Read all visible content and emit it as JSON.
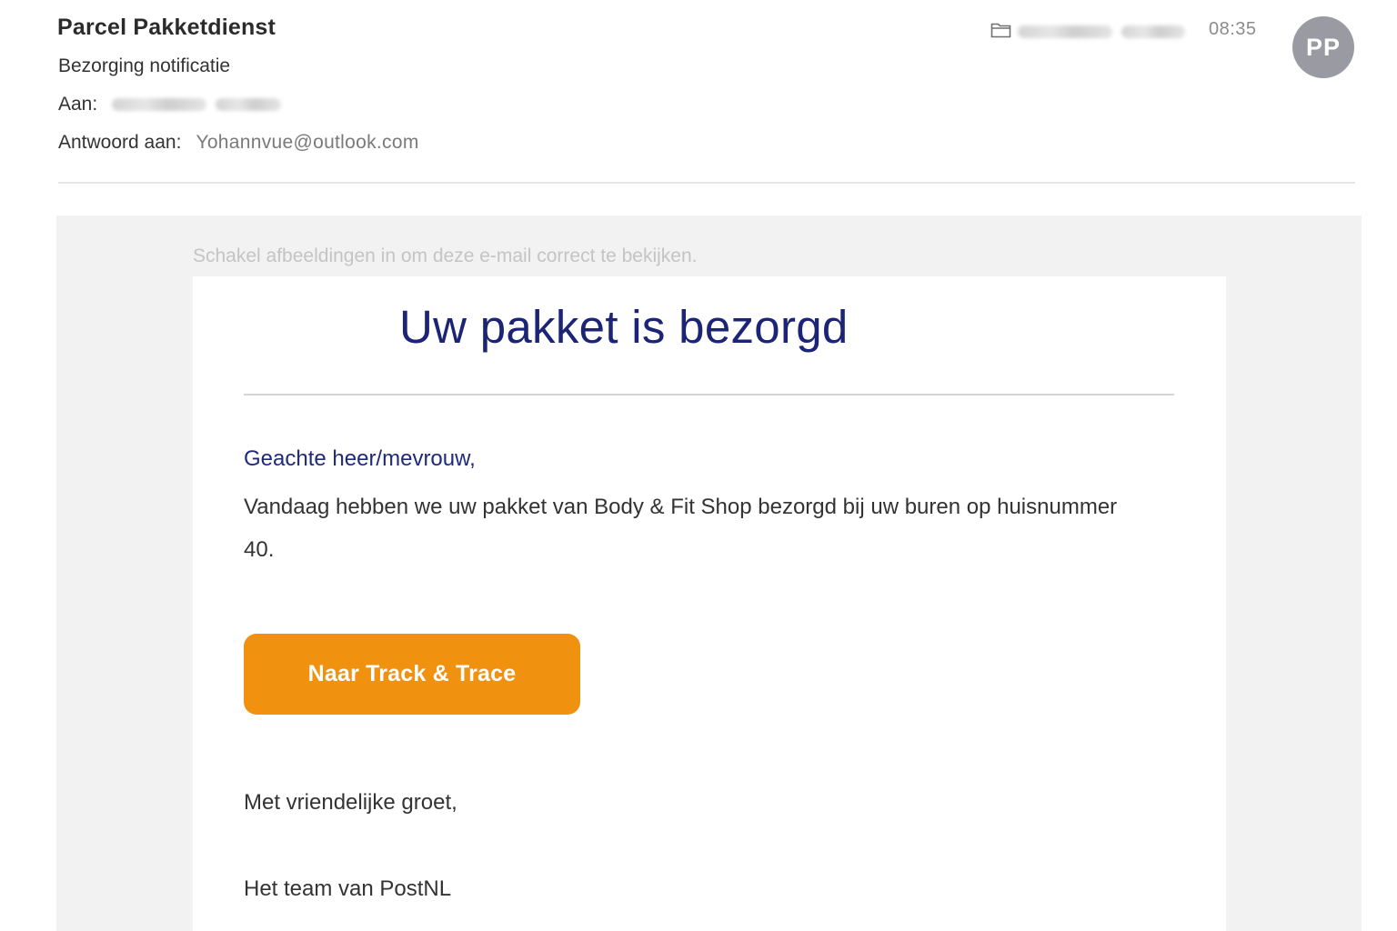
{
  "email": {
    "sender_name": "Parcel Pakketdienst",
    "subject": "Bezorging notificatie",
    "to_label": "Aan:",
    "reply_to_label": "Antwoord aan:",
    "reply_to_value": "Yohannvue@outlook.com",
    "time": "08:35",
    "avatar_initials": "PP",
    "folder_icon": "folder-icon"
  },
  "body": {
    "images_notice": "Schakel afbeeldingen in om deze e-mail correct te bekijken.",
    "title": "Uw pakket is bezorgd",
    "greeting": "Geachte heer/mevrouw,",
    "message": "Vandaag hebben we uw pakket van Body & Fit Shop bezorgd bij uw buren op huisnummer 40.",
    "button_label": "Naar Track & Trace",
    "closing": "Met vriendelijke groet,",
    "signature": "Het team van PostNL"
  },
  "colors": {
    "title_blue": "#1b2475",
    "button_orange": "#f0920f",
    "avatar_gray": "#9a9aa3",
    "body_background": "#f2f2f2"
  }
}
